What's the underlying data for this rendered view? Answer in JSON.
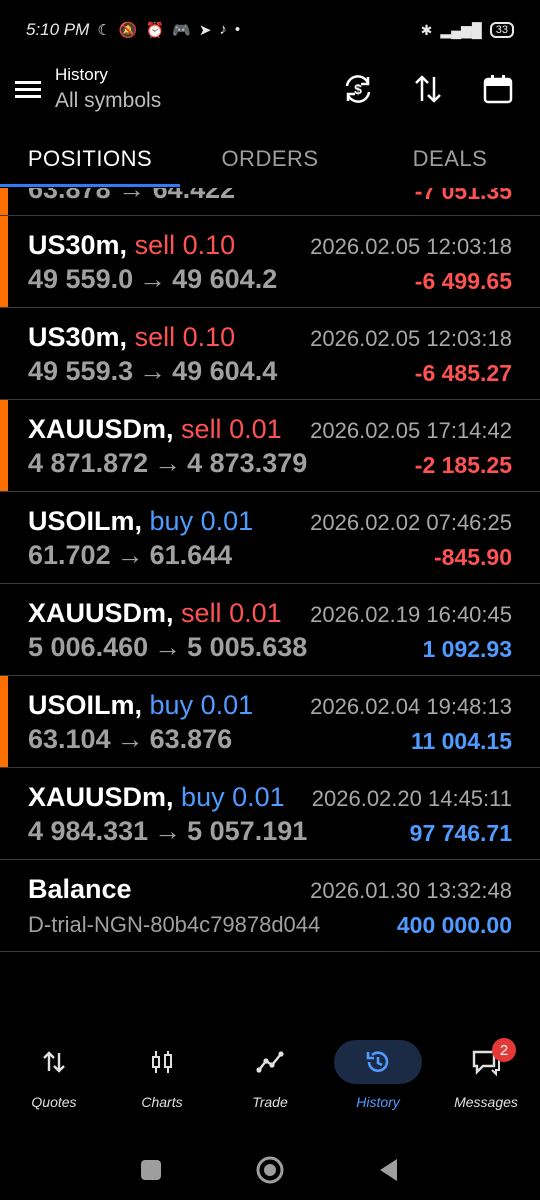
{
  "status": {
    "time": "5:10 PM",
    "battery": "33"
  },
  "header": {
    "title": "History",
    "subtitle": "All symbols"
  },
  "tabs": [
    {
      "label": "POSITIONS"
    },
    {
      "label": "ORDERS"
    },
    {
      "label": "DEALS"
    }
  ],
  "partial_row": {
    "prices": "63.878 → 64.422",
    "profit": "-7 051.35"
  },
  "deals": [
    {
      "symbol": "US30m,",
      "side": "sell",
      "volume": "0.10",
      "open": "49 559.0",
      "close": "49 604.2",
      "time": "2026.02.05 12:03:18",
      "profit": "-6 499.65",
      "marker": true
    },
    {
      "symbol": "US30m,",
      "side": "sell",
      "volume": "0.10",
      "open": "49 559.3",
      "close": "49 604.4",
      "time": "2026.02.05 12:03:18",
      "profit": "-6 485.27",
      "marker": false
    },
    {
      "symbol": "XAUUSDm,",
      "side": "sell",
      "volume": "0.01",
      "open": "4 871.872",
      "close": "4 873.379",
      "time": "2026.02.05 17:14:42",
      "profit": "-2 185.25",
      "marker": true
    },
    {
      "symbol": "USOILm,",
      "side": "buy",
      "volume": "0.01",
      "open": "61.702",
      "close": "61.644",
      "time": "2026.02.02 07:46:25",
      "profit": "-845.90",
      "marker": false
    },
    {
      "symbol": "XAUUSDm,",
      "side": "sell",
      "volume": "0.01",
      "open": "5 006.460",
      "close": "5 005.638",
      "time": "2026.02.19 16:40:45",
      "profit": "1 092.93",
      "marker": false
    },
    {
      "symbol": "USOILm,",
      "side": "buy",
      "volume": "0.01",
      "open": "63.104",
      "close": "63.876",
      "time": "2026.02.04 19:48:13",
      "profit": "11 004.15",
      "marker": true
    },
    {
      "symbol": "XAUUSDm,",
      "side": "buy",
      "volume": "0.01",
      "open": "4 984.331",
      "close": "5 057.191",
      "time": "2026.02.20 14:45:11",
      "profit": "97 746.71",
      "marker": false
    }
  ],
  "balance": {
    "label": "Balance",
    "account": "D-trial-NGN-80b4c79878d044",
    "time": "2026.01.30 13:32:48",
    "amount": "400 000.00"
  },
  "nav": [
    {
      "label": "Quotes"
    },
    {
      "label": "Charts"
    },
    {
      "label": "Trade"
    },
    {
      "label": "History"
    },
    {
      "label": "Messages",
      "badge": "2"
    }
  ],
  "colors": {
    "accent": "#4f9bff",
    "loss": "#ff5252",
    "marker": "#ff6f00",
    "tab_indicator": "#2f7cf6"
  }
}
